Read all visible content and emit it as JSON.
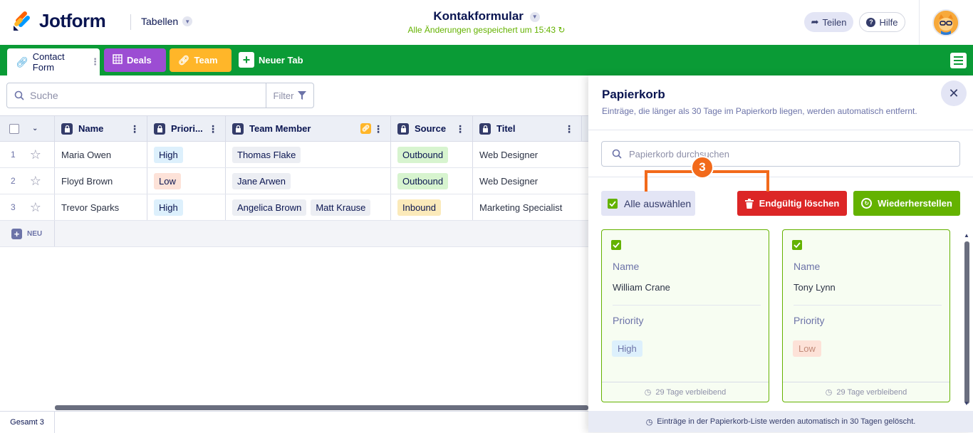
{
  "app": {
    "brand": "Jotform",
    "section": "Tabellen"
  },
  "header": {
    "form_title": "Kontakformular",
    "saved_status": "Alle Änderungen gespeichert um 15:43",
    "share_label": "Teilen",
    "help_label": "Hilfe"
  },
  "tabs": [
    {
      "label": "Contact Form",
      "color": "#ffffff"
    },
    {
      "label": "Deals",
      "color": "#9c4dd3"
    },
    {
      "label": "Team",
      "color": "#ffb629"
    },
    {
      "label": "Neuer Tab",
      "color": "#0a9b36"
    }
  ],
  "toolbar": {
    "search_placeholder": "Suche",
    "filter_label": "Filter"
  },
  "table": {
    "columns": [
      "Name",
      "Priori...",
      "Team Member",
      "Source",
      "Titel"
    ],
    "rows": [
      {
        "num": "1",
        "name": "Maria Owen",
        "priority": "High",
        "members": [
          "Thomas Flake"
        ],
        "source": "Outbound",
        "title": "Web Designer"
      },
      {
        "num": "2",
        "name": "Floyd Brown",
        "priority": "Low",
        "members": [
          "Jane Arwen"
        ],
        "source": "Outbound",
        "title": "Web Designer"
      },
      {
        "num": "3",
        "name": "Trevor Sparks",
        "priority": "High",
        "members": [
          "Angelica Brown",
          "Matt Krause"
        ],
        "source": "Inbound",
        "title": "Marketing Specialist"
      }
    ],
    "new_label": "NEU",
    "total_label": "Gesamt 3"
  },
  "trash": {
    "title": "Papierkorb",
    "subtitle": "Einträge, die länger als 30 Tage im Papierkorb liegen, werden automatisch entfernt.",
    "search_placeholder": "Papierkorb durchsuchen",
    "select_all_label": "Alle auswählen",
    "delete_label": "Endgültig löschen",
    "restore_label": "Wiederherstellen",
    "step_badge": "3",
    "cards": [
      {
        "name_label": "Name",
        "name_value": "William Crane",
        "priority_label": "Priority",
        "priority_value": "High",
        "remaining": "29 Tage verbleibend"
      },
      {
        "name_label": "Name",
        "name_value": "Tony Lynn",
        "priority_label": "Priority",
        "priority_value": "Low",
        "remaining": "29 Tage verbleibend"
      }
    ],
    "footer_note": "Einträge in der Papierkorb-Liste werden automatisch in 30 Tagen gelöscht."
  },
  "colors": {
    "brand_green": "#0a9b36",
    "accent_orange": "#f26a1b",
    "danger_red": "#dc2626",
    "success_green": "#64b200"
  }
}
